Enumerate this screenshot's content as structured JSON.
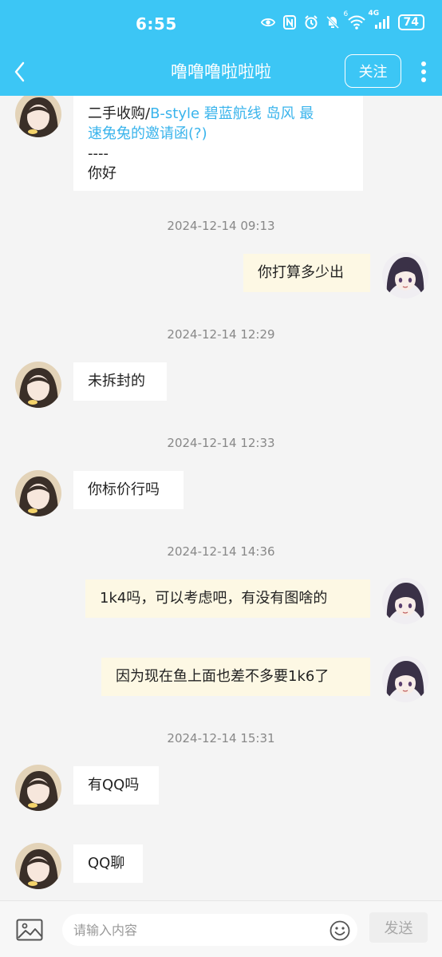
{
  "status_bar": {
    "time": "6:55",
    "battery": "74",
    "network": "4G",
    "wifi_badge": "6"
  },
  "header": {
    "title": "噜噜噜啦啦啦",
    "follow_label": "关注"
  },
  "messages": [
    {
      "side": "in",
      "lines": [
        {
          "plain": "二手收购/",
          "link": "B-style 碧蓝航线 岛风 最"
        },
        {
          "plain": "",
          "link": "速兔兔的邀请函(?)"
        },
        {
          "plain": "----",
          "link": ""
        },
        {
          "plain": "你好",
          "link": ""
        }
      ]
    },
    {
      "timestamp": "2024-12-14 09:13"
    },
    {
      "side": "out",
      "text": "你打算多少出"
    },
    {
      "timestamp": "2024-12-14 12:29"
    },
    {
      "side": "in",
      "text": "未拆封的"
    },
    {
      "timestamp": "2024-12-14 12:33"
    },
    {
      "side": "in",
      "text": "你标价行吗"
    },
    {
      "timestamp": "2024-12-14 14:36"
    },
    {
      "side": "out",
      "text": "1k4吗，可以考虑吧，有没有图啥的"
    },
    {
      "side": "out",
      "text": "因为现在鱼上面也差不多要1k6了"
    },
    {
      "timestamp": "2024-12-14 15:31"
    },
    {
      "side": "in",
      "text": "有QQ吗"
    },
    {
      "side": "in",
      "text": "QQ聊"
    }
  ],
  "input_bar": {
    "placeholder": "请输入内容",
    "send_label": "发送"
  },
  "colors": {
    "header_bg": "#3cc6f5",
    "link": "#3ab4ec",
    "outgoing_bubble": "#fdf8e4",
    "incoming_bubble": "#ffffff"
  },
  "icons": {
    "back": "chevron-left-icon",
    "more": "more-vertical-icon",
    "image": "image-icon",
    "emoji": "emoji-icon"
  }
}
